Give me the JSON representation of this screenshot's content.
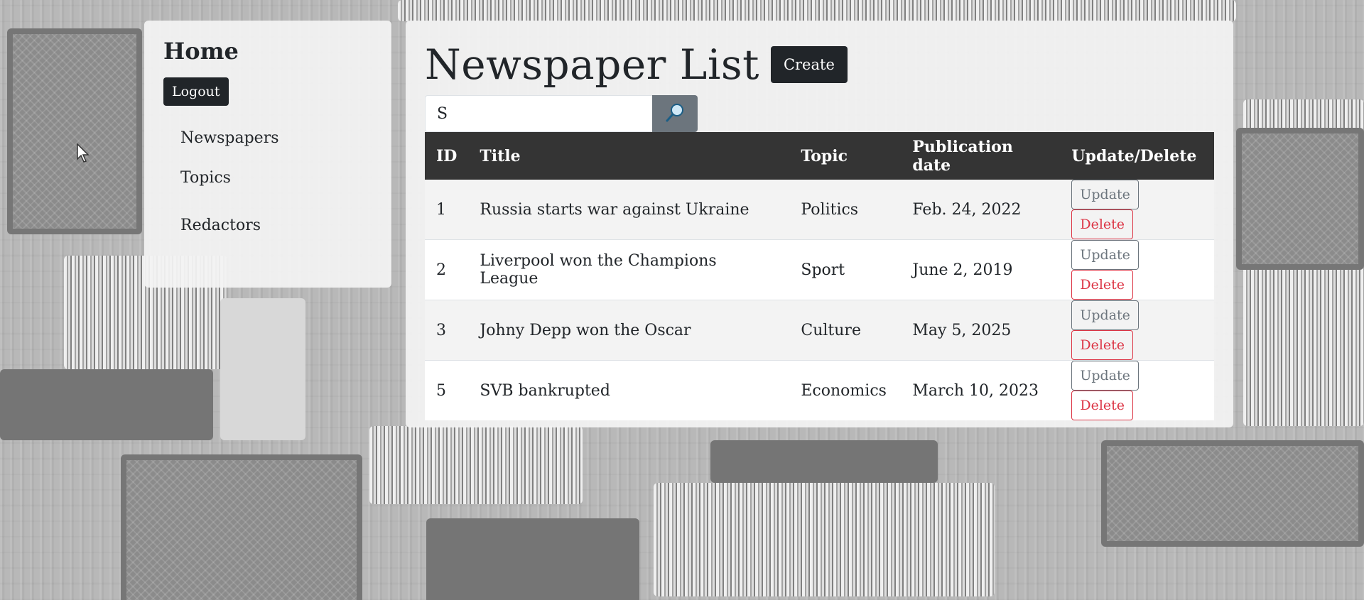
{
  "sidebar": {
    "home_label": "Home",
    "logout_label": "Logout",
    "nav_items": [
      {
        "label": "Newspapers"
      },
      {
        "label": "Topics"
      },
      {
        "label": "Redactors"
      }
    ]
  },
  "main": {
    "title": "Newspaper List",
    "create_label": "Create",
    "search": {
      "value": "S",
      "icon": "magnifier-icon"
    },
    "table": {
      "columns": [
        "ID",
        "Title",
        "Topic",
        "Publication date",
        "Update/Delete"
      ],
      "rows": [
        {
          "id": "1",
          "title": "Russia starts war against Ukraine",
          "topic": "Politics",
          "date": "Feb. 24, 2022",
          "update": "Update",
          "delete": "Delete"
        },
        {
          "id": "2",
          "title": "Liverpool won the Champions League",
          "topic": "Sport",
          "date": "June 2, 2019",
          "update": "Update",
          "delete": "Delete"
        },
        {
          "id": "3",
          "title": "Johny Depp won the Oscar",
          "topic": "Culture",
          "date": "May 5, 2025",
          "update": "Update",
          "delete": "Delete"
        },
        {
          "id": "5",
          "title": "SVB bankrupted",
          "topic": "Economics",
          "date": "March 10, 2023",
          "update": "Update",
          "delete": "Delete"
        }
      ]
    }
  },
  "colors": {
    "dark": "#212529",
    "header": "#343434",
    "secondary": "#6c757d",
    "danger": "#dc3545"
  }
}
